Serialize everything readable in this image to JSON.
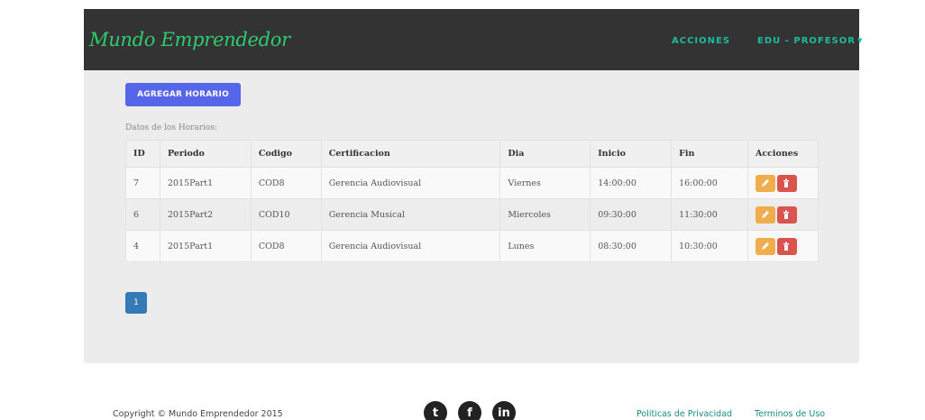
{
  "brand": "Mundo Emprendedor",
  "nav": {
    "acciones": "ACCIONES",
    "profile": "EDU - PROFESOR"
  },
  "toolbar": {
    "add_label": "AGREGAR HORARIO"
  },
  "table": {
    "caption": "Datos de los Horarios:",
    "headers": [
      "ID",
      "Periodo",
      "Codigo",
      "Certificacion",
      "Dia",
      "Inicio",
      "Fin",
      "Acciones"
    ],
    "rows": [
      {
        "id": "7",
        "periodo": "2015Part1",
        "codigo": "COD8",
        "certificacion": "Gerencia Audiovisual",
        "dia": "Viernes",
        "inicio": "14:00:00",
        "fin": "16:00:00"
      },
      {
        "id": "6",
        "periodo": "2015Part2",
        "codigo": "COD10",
        "certificacion": "Gerencia Musical",
        "dia": "Miercoles",
        "inicio": "09:30:00",
        "fin": "11:30:00"
      },
      {
        "id": "4",
        "periodo": "2015Part1",
        "codigo": "COD8",
        "certificacion": "Gerencia Audiovisual",
        "dia": "Lunes",
        "inicio": "08:30:00",
        "fin": "10:30:00"
      }
    ]
  },
  "pagination": {
    "current_page": "1"
  },
  "footer": {
    "copyright": "Copyright © Mundo Emprendedor 2015",
    "social": [
      {
        "name": "twitter-icon",
        "glyph": "t"
      },
      {
        "name": "facebook-icon",
        "glyph": "f"
      },
      {
        "name": "linkedin-icon",
        "glyph": "in"
      }
    ],
    "privacy": "Politicas de Privacidad",
    "terms": "Terminos de Uso"
  },
  "colors": {
    "navbar": "#333333",
    "brand": "#2ecc71",
    "nav_link": "#1abc9c",
    "primary_button": "#5566ea",
    "edit_button": "#f0ad4e",
    "delete_button": "#d9534f",
    "pagination": "#337ab7"
  }
}
